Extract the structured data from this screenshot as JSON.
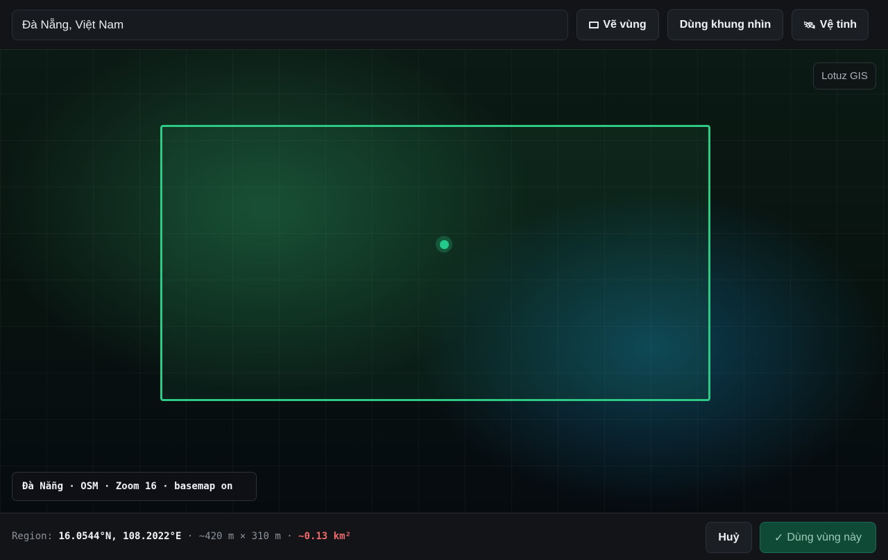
{
  "toolbar": {
    "search_value": "Đà Nẵng, Việt Nam",
    "draw_label": "Vẽ vùng",
    "use_view_label": "Dùng khung nhìn",
    "satellite_label": "Vệ tinh",
    "satellite_icon": "🛰"
  },
  "map": {
    "brand": "Lotuz GIS",
    "info": "Đà Nẵng · OSM · Zoom 16 · basemap on"
  },
  "footer": {
    "region_label": "Region:",
    "coords": "16.0544°N, 108.2022°E",
    "dims": "· ~420 m × 310 m ·",
    "area": "~0.13 km²",
    "cancel_label": "Huỷ",
    "apply_check": "✓",
    "apply_label": "Dùng vùng này"
  },
  "colors": {
    "accent": "#2ec985",
    "area_warning": "#f06a6a",
    "apply_bg": "#0f4a37"
  }
}
